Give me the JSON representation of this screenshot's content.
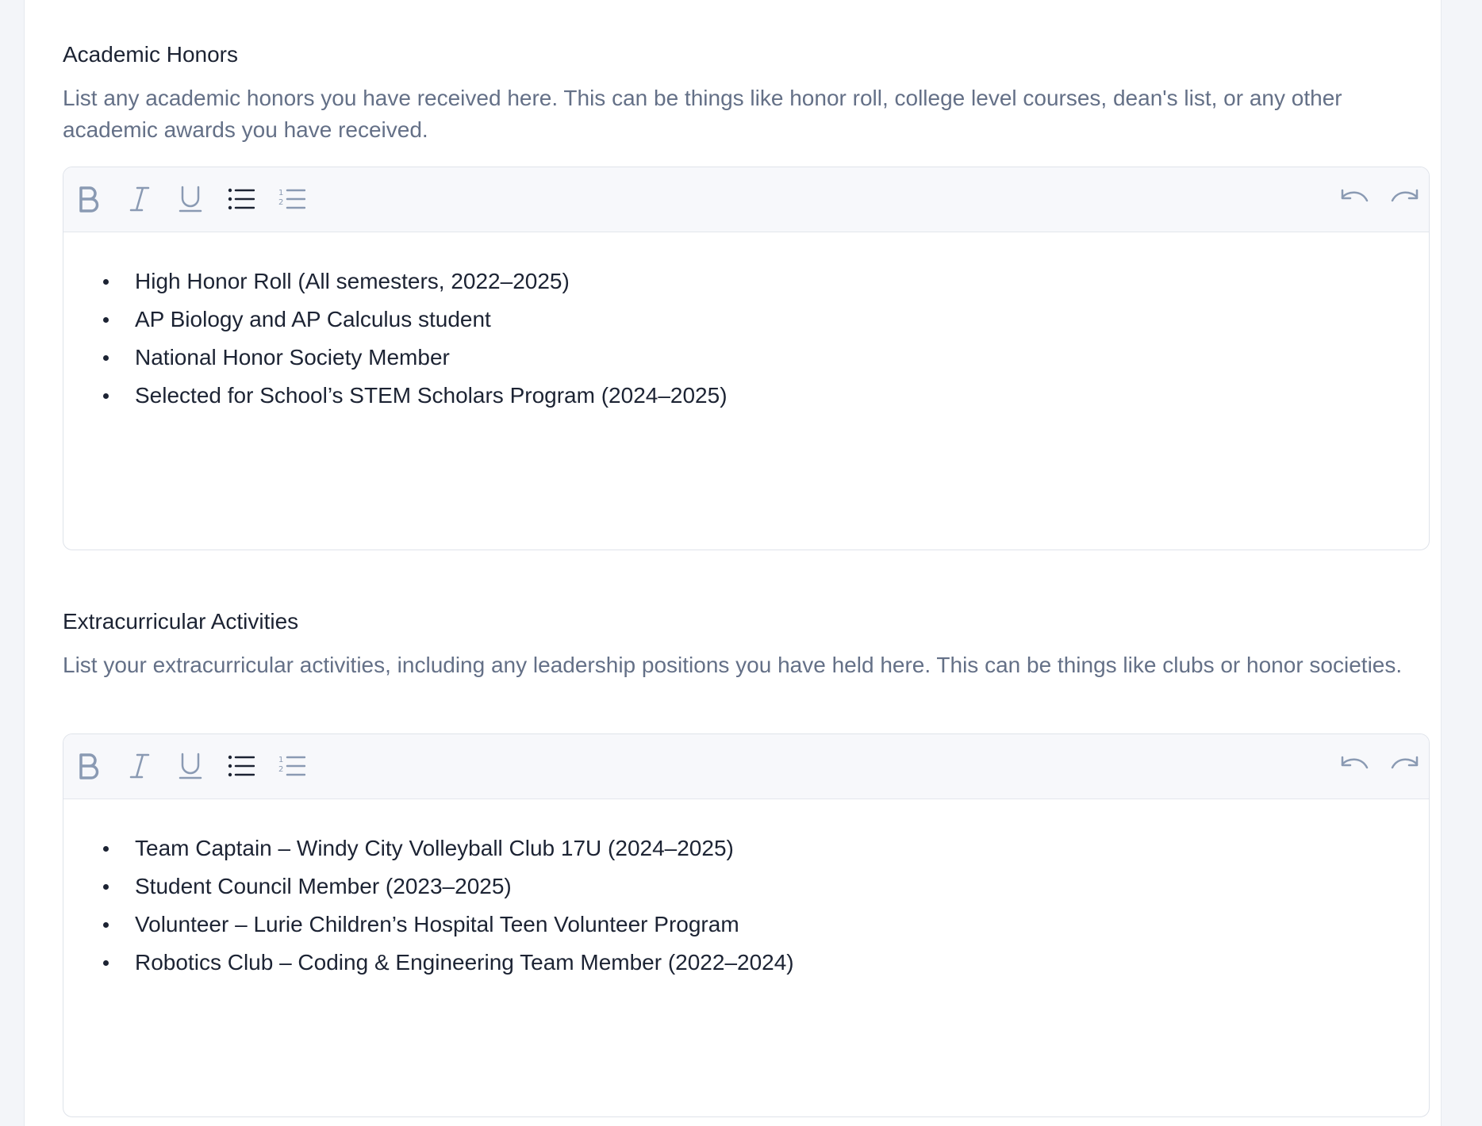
{
  "honors": {
    "title": "Academic Honors",
    "description": "List any academic honors you have received here. This can be things like honor roll, college level courses, dean's list, or any other academic awards you have received.",
    "items": [
      "High Honor Roll (All semesters, 2022–2025)",
      "AP Biology and AP Calculus student",
      "National Honor Society Member",
      "Selected for School’s STEM Scholars Program (2024–2025)"
    ]
  },
  "extracurricular": {
    "title": "Extracurricular Activities",
    "description": "List your extracurricular activities, including any leadership positions you have held here. This can be things like clubs or honor societies.",
    "items": [
      "Team Captain – Windy City Volleyball Club 17U (2024–2025)",
      "Student Council Member (2023–2025)",
      "Volunteer – Lurie Children’s Hospital Teen Volunteer Program",
      "Robotics Club – Coding & Engineering Team Member (2022–2024)"
    ]
  },
  "toolbar": {
    "icons": [
      "bold-icon",
      "italic-icon",
      "underline-icon",
      "bullet-list-icon",
      "numbered-list-icon",
      "undo-icon",
      "redo-icon"
    ]
  },
  "colors": {
    "title": "#1c2333",
    "description": "#647087",
    "toolbar_icon": "#8a9ab3",
    "toolbar_icon_active": "#1c2333",
    "spellcheck": "#e0322f"
  }
}
